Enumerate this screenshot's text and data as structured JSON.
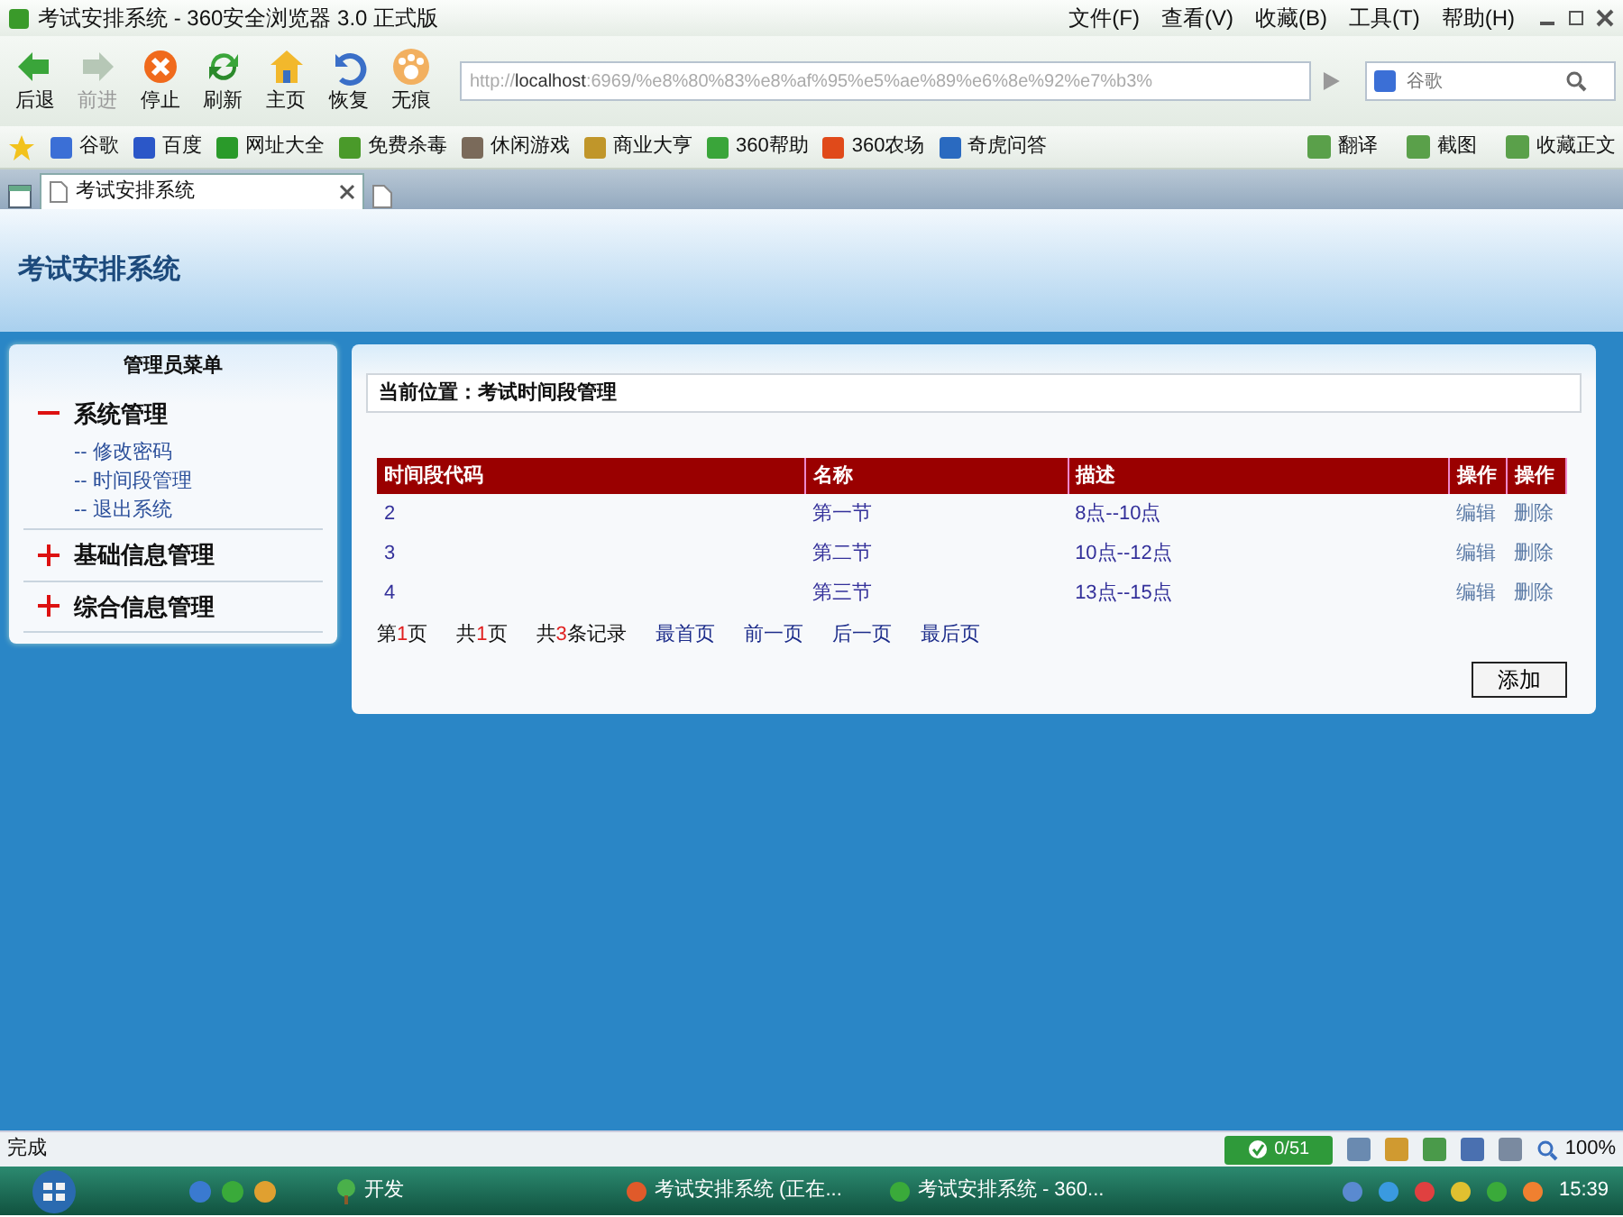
{
  "window": {
    "title": "考试安排系统 - 360安全浏览器 3.0 正式版"
  },
  "menu": [
    "文件(F)",
    "查看(V)",
    "收藏(B)",
    "工具(T)",
    "帮助(H)"
  ],
  "toolbar": [
    {
      "label": "后退",
      "disabled": false
    },
    {
      "label": "前进",
      "disabled": true
    },
    {
      "label": "停止",
      "disabled": false
    },
    {
      "label": "刷新",
      "disabled": false
    },
    {
      "label": "主页",
      "disabled": false
    },
    {
      "label": "恢复",
      "disabled": false
    },
    {
      "label": "无痕",
      "disabled": false
    }
  ],
  "address": {
    "value": "http://localhost:6969/%e8%80%83%e8%af%95%e5%ae%89%e6%8e%92%e7%b3%"
  },
  "search": {
    "placeholder": "谷歌"
  },
  "bookmarks": [
    "谷歌",
    "百度",
    "网址大全",
    "免费杀毒",
    "休闲游戏",
    "商业大亨",
    "360帮助",
    "360农场",
    "奇虎问答"
  ],
  "bookmark_tools": [
    "翻译",
    "截图",
    "收藏正文"
  ],
  "tabs": [
    {
      "label": "考试安排系统",
      "selected": true
    }
  ],
  "page": {
    "header": "考试安排系统",
    "sidebar": {
      "title": "管理员菜单",
      "groups": [
        {
          "label": "系统管理",
          "expanded": true,
          "items": [
            "-- 修改密码",
            "-- 时间段管理",
            "-- 退出系统"
          ]
        },
        {
          "label": "基础信息管理",
          "expanded": false
        },
        {
          "label": "综合信息管理",
          "expanded": false
        }
      ]
    },
    "breadcrumb": "当前位置：考试时间段管理",
    "table": {
      "columns": [
        "时间段代码",
        "名称",
        "描述",
        "操作",
        "操作"
      ],
      "rows": [
        [
          "2",
          "第一节",
          "8点--10点",
          "编辑",
          "删除"
        ],
        [
          "3",
          "第二节",
          "10点--12点",
          "编辑",
          "删除"
        ],
        [
          "4",
          "第三节",
          "13点--15点",
          "编辑",
          "删除"
        ]
      ]
    },
    "pager": [
      {
        "kind": "count",
        "before": "第",
        "number": "1",
        "after": "页"
      },
      {
        "kind": "count",
        "before": "共",
        "number": "1",
        "after": "页"
      },
      {
        "kind": "count",
        "before": "共",
        "number": "3",
        "after": "条记录"
      },
      {
        "kind": "link",
        "text": "最首页"
      },
      {
        "kind": "link",
        "text": "前一页"
      },
      {
        "kind": "link",
        "text": "后一页"
      },
      {
        "kind": "link",
        "text": "最后页"
      }
    ],
    "add_button": "添加"
  },
  "status_bar": {
    "text": "完成",
    "counter": "0/51",
    "zoom": "100%"
  },
  "taskbar": {
    "quick_label": "开发",
    "tasks": [
      "考试安排系统 (正在...",
      "考试安排系统 - 360..."
    ],
    "clock": "15:39"
  }
}
